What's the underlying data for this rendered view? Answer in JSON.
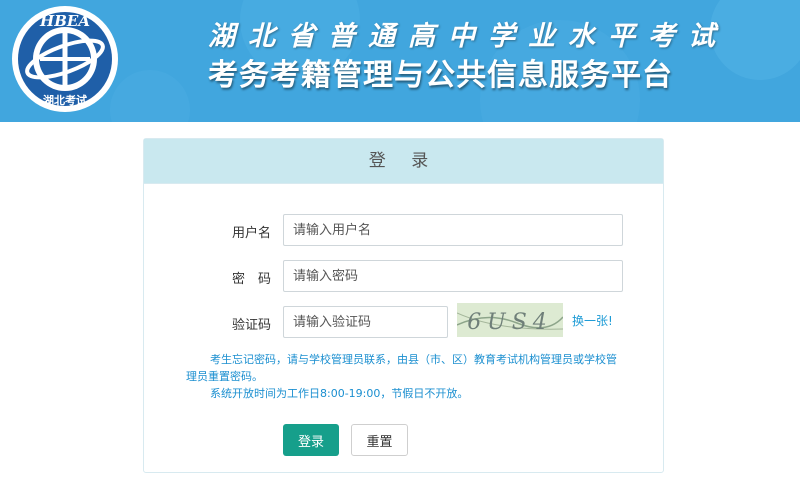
{
  "header": {
    "logo_text_top": "HBEA",
    "logo_text_bottom": "湖北考试",
    "title_line1": "湖北省普通高中学业水平考试",
    "title_line2": "考务考籍管理与公共信息服务平台",
    "bg_color": "#41a6de"
  },
  "login": {
    "heading": "登 录",
    "username_label": "用户名",
    "username_placeholder": "请输入用户名",
    "password_label": "密　码",
    "password_placeholder": "请输入密码",
    "captcha_label": "验证码",
    "captcha_placeholder": "请输入验证码",
    "captcha_text": "6US4",
    "refresh_label": "换一张!",
    "notice_line1": "考生忘记密码，请与学校管理员联系，由县（市、区）教育考试机构管理员或学校管理员重置密码。",
    "notice_line2": "系统开放时间为工作日8:00-19:00，节假日不开放。",
    "login_button": "登录",
    "reset_button": "重置",
    "primary_color": "#169f8b",
    "panel_head_color": "#c9e8ef",
    "notice_color": "#1b8fd0"
  }
}
